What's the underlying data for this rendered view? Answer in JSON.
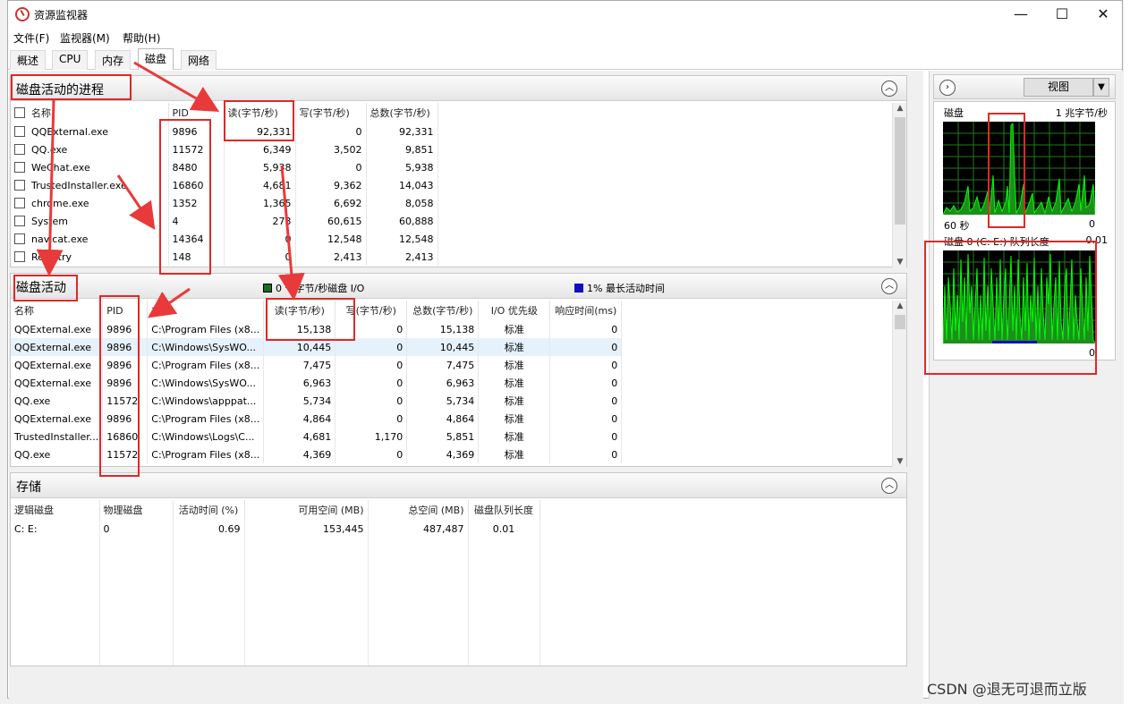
{
  "window": {
    "title": "资源监视器",
    "minimize": "—",
    "maximize": "☐",
    "close": "✕"
  },
  "menu": [
    "文件(F)",
    "监视器(M)",
    "帮助(H)"
  ],
  "tabs": [
    "概述",
    "CPU",
    "内存",
    "磁盘",
    "网络"
  ],
  "active_tab": "磁盘",
  "processes": {
    "title": "磁盘活动的进程",
    "columns": [
      "名称",
      "PID",
      "读(字节/秒)",
      "写(字节/秒)",
      "总数(字节/秒)"
    ],
    "rows": [
      [
        "QQExternal.exe",
        "9896",
        "92,331",
        "0",
        "92,331"
      ],
      [
        "QQ.exe",
        "11572",
        "6,349",
        "3,502",
        "9,851"
      ],
      [
        "WeChat.exe",
        "8480",
        "5,938",
        "0",
        "5,938"
      ],
      [
        "TrustedInstaller.exe",
        "16860",
        "4,681",
        "9,362",
        "14,043"
      ],
      [
        "chrome.exe",
        "1352",
        "1,365",
        "6,692",
        "8,058"
      ],
      [
        "System",
        "4",
        "273",
        "60,615",
        "60,888"
      ],
      [
        "navicat.exe",
        "14364",
        "0",
        "12,548",
        "12,548"
      ],
      [
        "Registry",
        "148",
        "0",
        "2,413",
        "2,413"
      ]
    ]
  },
  "disk_activity": {
    "title": "磁盘活动",
    "io_info": "0 千字节/秒磁盘 I/O",
    "active_info": "1% 最长活动时间",
    "io_color": "#1d6b1d",
    "active_color": "#1010c0",
    "columns": [
      "名称",
      "PID",
      "文件",
      "读(字节/秒)",
      "写(字节/秒)",
      "总数(字节/秒)",
      "I/O 优先级",
      "响应时间(ms)"
    ],
    "rows": [
      [
        "QQExternal.exe",
        "9896",
        "C:\\Program Files (x8...",
        "15,138",
        "0",
        "15,138",
        "标准",
        "0"
      ],
      [
        "QQExternal.exe",
        "9896",
        "C:\\Windows\\SysWO...",
        "10,445",
        "0",
        "10,445",
        "标准",
        "0"
      ],
      [
        "QQExternal.exe",
        "9896",
        "C:\\Program Files (x8...",
        "7,475",
        "0",
        "7,475",
        "标准",
        "0"
      ],
      [
        "QQExternal.exe",
        "9896",
        "C:\\Windows\\SysWO...",
        "6,963",
        "0",
        "6,963",
        "标准",
        "0"
      ],
      [
        "QQ.exe",
        "11572",
        "C:\\Windows\\apppat...",
        "5,734",
        "0",
        "5,734",
        "标准",
        "0"
      ],
      [
        "QQExternal.exe",
        "9896",
        "C:\\Program Files (x8...",
        "4,864",
        "0",
        "4,864",
        "标准",
        "0"
      ],
      [
        "TrustedInstaller...",
        "16860",
        "C:\\Windows\\Logs\\C...",
        "4,681",
        "1,170",
        "5,851",
        "标准",
        "0"
      ],
      [
        "QQ.exe",
        "11572",
        "C:\\Program Files (x8...",
        "4,369",
        "0",
        "4,369",
        "标准",
        "0"
      ]
    ]
  },
  "storage": {
    "title": "存储",
    "columns": [
      "逻辑磁盘",
      "物理磁盘",
      "活动时间 (%)",
      "可用空间 (MB)",
      "总空间 (MB)",
      "磁盘队列长度"
    ],
    "rows": [
      [
        "C: E:",
        "0",
        "0.69",
        "153,445",
        "487,487",
        "0.01"
      ]
    ]
  },
  "side": {
    "view_label": "视图",
    "disk_label": "磁盘",
    "disk_scale": "1 兆字节/秒",
    "disk_time": "60 秒",
    "disk_min": "0",
    "queue_label": "磁盘 0 (C: E:) 队列长度",
    "queue_max": "0.01",
    "queue_min": "0",
    "graph_color": "#00ff00"
  },
  "watermark": "CSDN @退无可退而立版"
}
